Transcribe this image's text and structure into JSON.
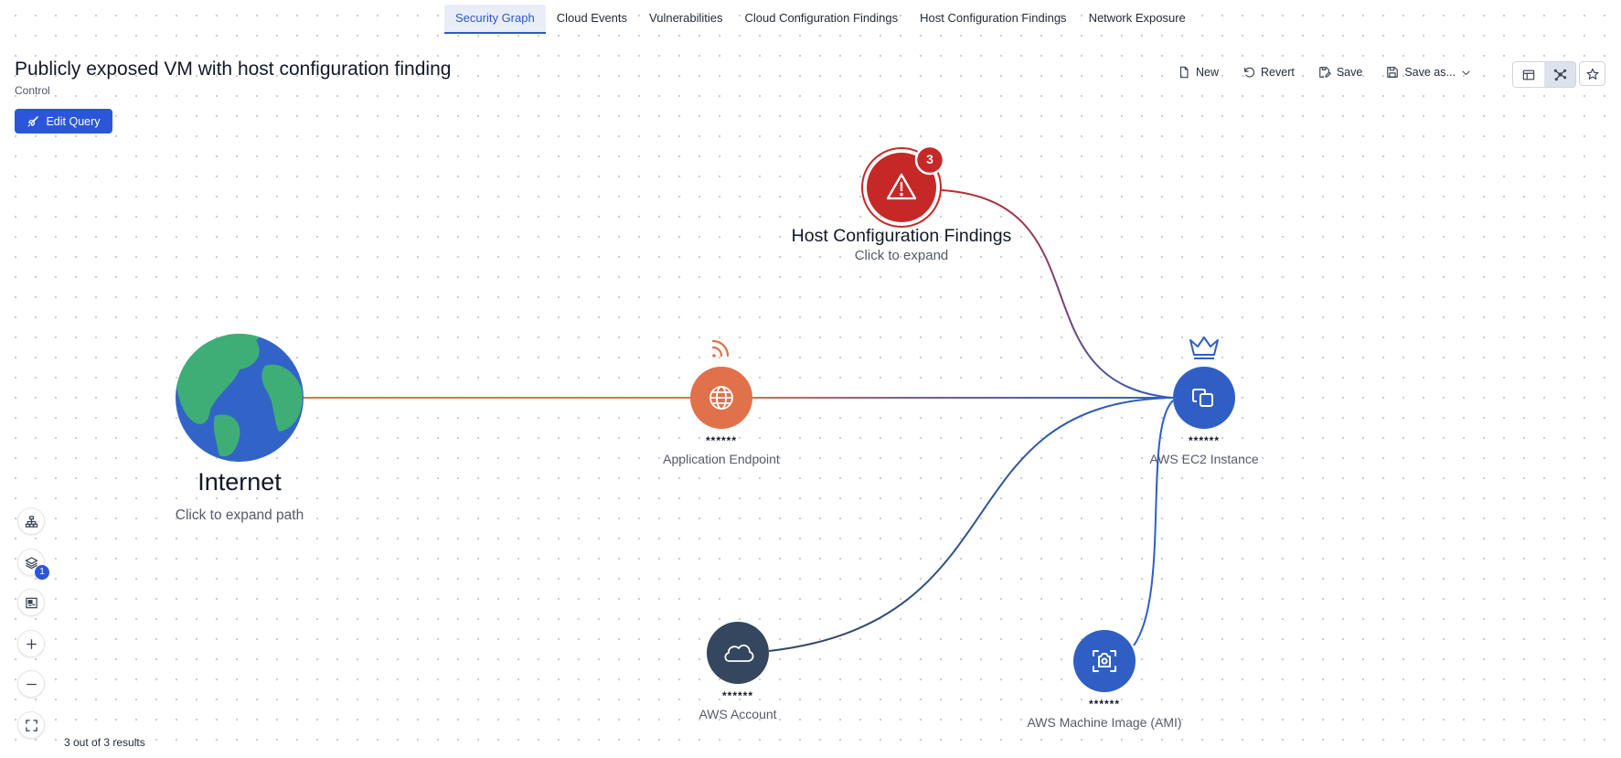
{
  "tabs": [
    {
      "label": "Security Graph",
      "active": true
    },
    {
      "label": "Cloud Events",
      "active": false
    },
    {
      "label": "Vulnerabilities",
      "active": false
    },
    {
      "label": "Cloud Configuration Findings",
      "active": false
    },
    {
      "label": "Host Configuration Findings",
      "active": false
    },
    {
      "label": "Network Exposure",
      "active": false
    }
  ],
  "header": {
    "title": "Publicly exposed VM with host configuration finding",
    "subtitle": "Control",
    "edit_query_label": "Edit Query"
  },
  "toolbar": {
    "new_label": "New",
    "revert_label": "Revert",
    "save_label": "Save",
    "save_as_label": "Save as..."
  },
  "graph": {
    "internet": {
      "title": "Internet",
      "hint": "Click to expand path"
    },
    "findings": {
      "title": "Host Configuration Findings",
      "hint": "Click to expand",
      "count": "3"
    },
    "endpoint": {
      "name": "******",
      "type": "Application Endpoint"
    },
    "ec2": {
      "name": "******",
      "type": "AWS EC2 Instance"
    },
    "account": {
      "name": "******",
      "type": "AWS Account"
    },
    "ami": {
      "name": "******",
      "type": "AWS Machine Image (AMI)"
    }
  },
  "controls": {
    "layers_badge": "1"
  },
  "results_text": "3 out of 3 results",
  "colors": {
    "accent": "#2c56d9",
    "finding_red": "#c62828",
    "endpoint_orange": "#e0714a",
    "resource_blue": "#2f5fc4",
    "account_slate": "#34475e"
  }
}
